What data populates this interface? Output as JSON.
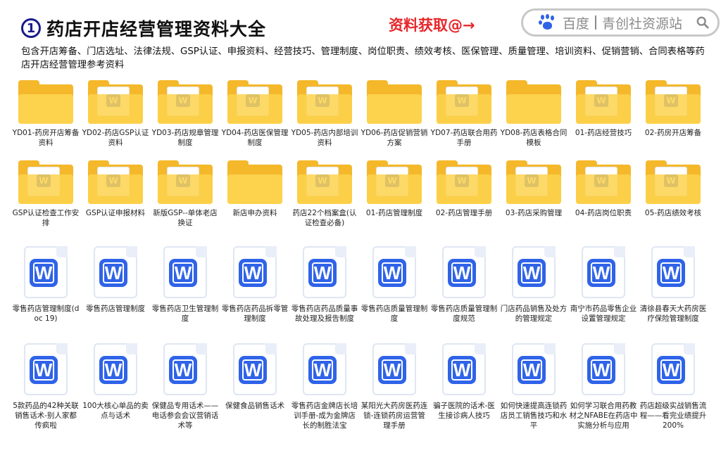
{
  "header": {
    "number": "1",
    "title": "药店开店经营管理资料大全",
    "promo": "资料获取@→",
    "search": {
      "engine": "百度",
      "site": "青创社资源站"
    },
    "description": "包含开店筹备、门店选址、法律法规、GSP认证、申报资料、经营技巧、管理制度、岗位职责、绩效考核、医保管理、质量管理、培训资料、促销营销、合同表格等药店开店经营管理参考资料"
  },
  "folders_row1": [
    {
      "label": "YD01-药房开店筹备资料",
      "preview": false
    },
    {
      "label": "YD02-药店GSP认证资料",
      "preview": true
    },
    {
      "label": "YD03-药店规章管理制度",
      "preview": true
    },
    {
      "label": "YD04-药店医保管理制度",
      "preview": true
    },
    {
      "label": "YD05-药店内部培训资料",
      "preview": true
    },
    {
      "label": "YD06-药店促销营销方案",
      "preview": false
    },
    {
      "label": "YD07-药店联合用药手册",
      "preview": true
    },
    {
      "label": "YD08-药店表格合同模板",
      "preview": false
    },
    {
      "label": "01-药店经营技巧",
      "preview": true
    },
    {
      "label": "02-药房开店筹备",
      "preview": true
    }
  ],
  "folders_row2": [
    {
      "label": "GSP认证检查工作安排",
      "preview": true
    },
    {
      "label": "GSP认证申报材料",
      "preview": true
    },
    {
      "label": "新版GSP--单体老店换证",
      "preview": true
    },
    {
      "label": "新店申办资料",
      "preview": false
    },
    {
      "label": "药店22个档案盒(认证检查必备)",
      "preview": true
    },
    {
      "label": "01-药店管理制度",
      "preview": true
    },
    {
      "label": "02-药店管理手册",
      "preview": true
    },
    {
      "label": "03-药店采购管理",
      "preview": true
    },
    {
      "label": "04-药店岗位职责",
      "preview": true
    },
    {
      "label": "05-药店绩效考核",
      "preview": true
    }
  ],
  "docs_row1": [
    "零售药店管理制度(doc 19)",
    "零售药店管理制度",
    "零售药店卫生管理制度",
    "零售药店药品拆零管理制度",
    "零售药店药品质量事故处理及报告制度",
    "零售药店质量管理制度",
    "零售药店质量管理制度规范",
    "门店药品销售及处方的管理规定",
    "南宁市药品零售企业设置管理规定",
    "清徐县春天大药房医疗保险管理制度"
  ],
  "docs_row2": [
    "5款药品的42种关联销售话术-别人家都传疯啦",
    "100大核心单品的卖点与话术",
    "保健品专用话术——电话参会会议营销话术等",
    "保健食品销售话术",
    "零售药店金牌店长培训手册-成为金牌店长的制胜法宝",
    "某阳光大药房医药连锁-连锁药房运营管理手册",
    "骗子医院的话术-医生接诊病人技巧",
    "如何快速提高连锁药店员工销售技巧和水平",
    "如何学习联合用药教材之NFABE在药店中实施分析与应用",
    "药店超级实战销售流程——看完业绩提升200%"
  ],
  "colors": {
    "folder_back": "#f4b82a",
    "folder_front": "#fdd24d",
    "word_blue": "#2f63e8",
    "promo_red": "#e8262a"
  },
  "icons": {
    "folder": "folder-icon",
    "word": "word-doc-icon",
    "paw": "baidu-paw-icon",
    "search": "search-icon"
  }
}
